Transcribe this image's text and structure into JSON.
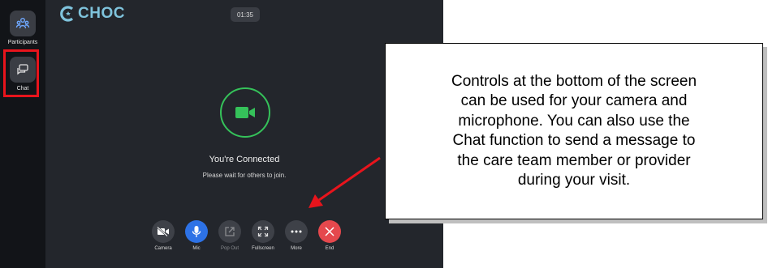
{
  "sidebar": {
    "items": [
      {
        "label": "Participants",
        "icon": "participants-icon"
      },
      {
        "label": "Chat",
        "icon": "chat-icon"
      }
    ]
  },
  "header": {
    "logo_text": "CHOC",
    "timer": "01:35"
  },
  "main": {
    "status_title": "You're Connected",
    "status_subtitle": "Please wait for others to join."
  },
  "controls": [
    {
      "label": "Camera",
      "icon": "camera-off-icon"
    },
    {
      "label": "Mic",
      "icon": "microphone-icon"
    },
    {
      "label": "Pop Out",
      "icon": "pop-out-icon"
    },
    {
      "label": "Fullscreen",
      "icon": "fullscreen-icon"
    },
    {
      "label": "More",
      "icon": "more-icon"
    },
    {
      "label": "End",
      "icon": "end-call-icon"
    }
  ],
  "callout": {
    "text": "Controls at the bottom of the screen\ncan be used for your camera and\nmicrophone.  You can also use the\nChat function to send a message to\nthe care team member or provider\nduring your visit."
  },
  "colors": {
    "stage_bg": "#23262c",
    "rail_bg": "#121418",
    "accent_green": "#35c25a",
    "mic_blue": "#2d72e6",
    "end_red": "#e5484d",
    "highlight_red": "#e8141c",
    "logo_blue": "#7fc3dc"
  }
}
